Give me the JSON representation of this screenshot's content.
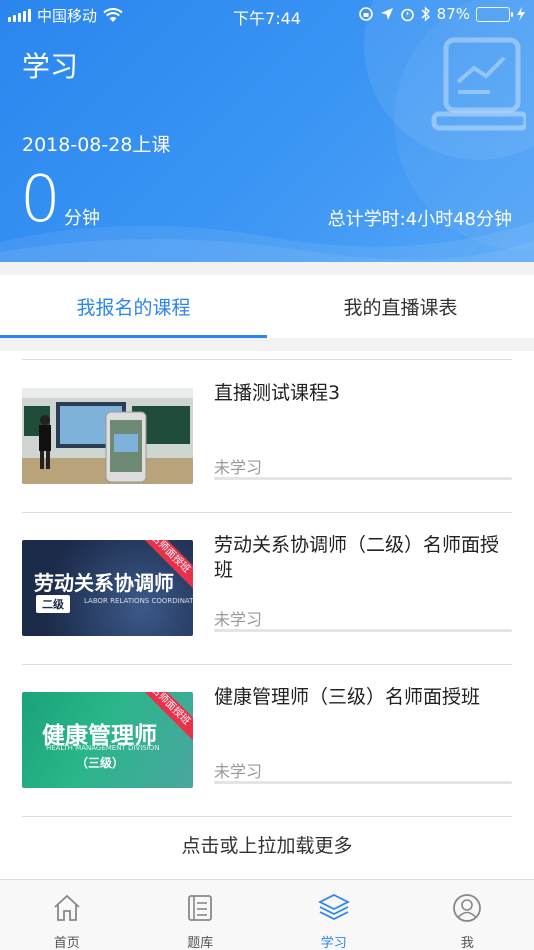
{
  "status_bar": {
    "carrier": "中国移动",
    "time": "下午7:44",
    "battery_percent": "87%",
    "battery_level": 0.87
  },
  "header": {
    "title": "学习",
    "date": "2018-08-28上课",
    "minutes": "0",
    "minutes_unit": "分钟",
    "total": "总计学时:4小时48分钟"
  },
  "tabs": [
    {
      "label": "我报名的课程",
      "active": true
    },
    {
      "label": "我的直播课表",
      "active": false
    }
  ],
  "courses": [
    {
      "title": "直播测试课程3",
      "status": "未学习",
      "progress": 0,
      "thumb_text": ""
    },
    {
      "title": "劳动关系协调师（二级）名师面授班",
      "status": "未学习",
      "progress": 0,
      "thumb_text": "劳动关系协调师",
      "thumb_sub": "二级",
      "thumb_en": "LABOR RELATIONS COORDINATOR",
      "ribbon": "名师面授班"
    },
    {
      "title": "健康管理师（三级）名师面授班",
      "status": "未学习",
      "progress": 0,
      "thumb_text": "健康管理师",
      "thumb_sub": "（三级）",
      "thumb_en": "HEALTH MANAGEMENT DIVISION",
      "ribbon": "名师面授班"
    }
  ],
  "load_more": "点击或上拉加载更多",
  "nav": [
    {
      "label": "首页",
      "icon": "home-icon"
    },
    {
      "label": "题库",
      "icon": "question-bank-icon"
    },
    {
      "label": "学习",
      "icon": "layers-icon",
      "active": true
    },
    {
      "label": "我",
      "icon": "user-icon"
    }
  ],
  "colors": {
    "accent": "#2a86ee",
    "ribbon": "#e8324b"
  }
}
